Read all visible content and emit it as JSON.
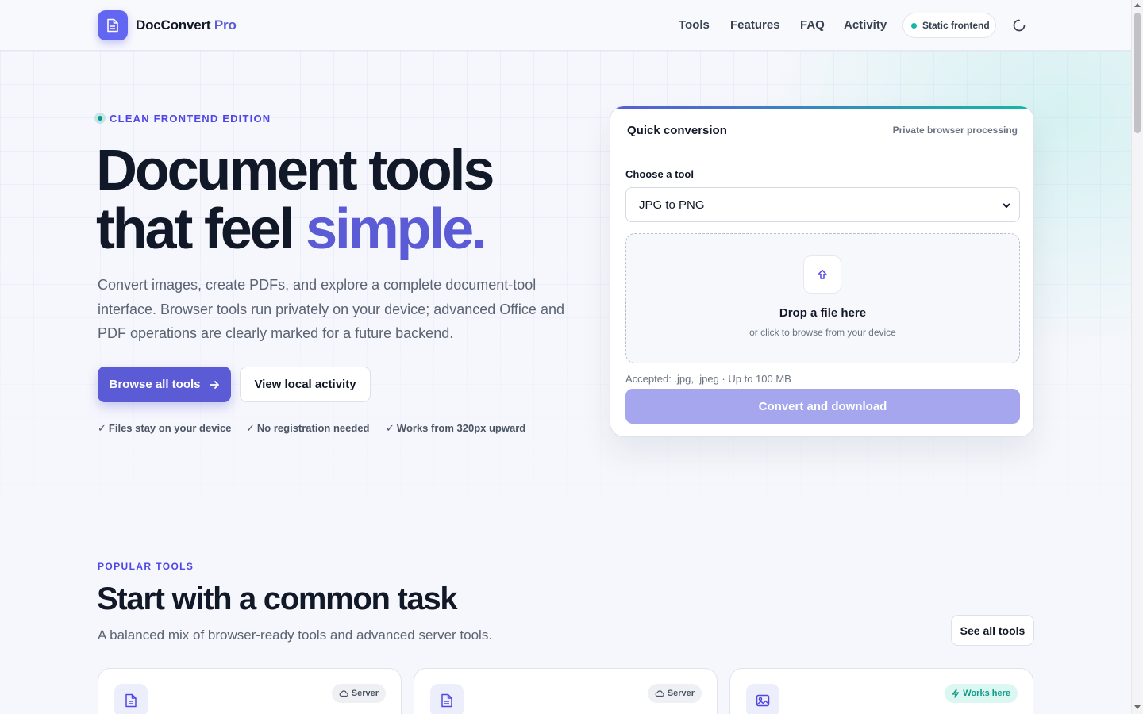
{
  "header": {
    "brand_name": "DocConvert",
    "brand_suffix": "Pro",
    "nav": [
      {
        "label": "Tools"
      },
      {
        "label": "Features"
      },
      {
        "label": "FAQ"
      },
      {
        "label": "Activity"
      }
    ],
    "status_label": "Static frontend",
    "icons": {
      "logo": "document-icon",
      "theme": "moon-icon"
    }
  },
  "hero": {
    "eyebrow": "CLEAN FRONTEND EDITION",
    "title_line1": "Document tools",
    "title_line2_prefix": "that feel ",
    "title_accent": "simple.",
    "description": "Convert images, create PDFs, and explore a complete document-tool interface. Browser tools run privately on your device; advanced Office and PDF operations are clearly marked for a future backend.",
    "primary_button": "Browse all tools",
    "secondary_button": "View local activity",
    "checks": [
      "Files stay on your device",
      "No registration needed",
      "Works from 320px upward"
    ]
  },
  "quick_card": {
    "title": "Quick conversion",
    "subtitle": "Private browser processing",
    "field_label": "Choose a tool",
    "selected_tool": "JPG to PNG",
    "drop_title": "Drop a file here",
    "drop_subtitle": "or click to browse from your device",
    "accepted": "Accepted: .jpg, .jpeg · Up to 100 MB",
    "convert_button": "Convert and download"
  },
  "popular": {
    "eyebrow": "POPULAR TOOLS",
    "title": "Start with a common task",
    "description": "A balanced mix of browser-ready tools and advanced server tools.",
    "see_all": "See all tools",
    "cards": [
      {
        "badge": "Server",
        "icon": "document-icon"
      },
      {
        "badge": "Server",
        "icon": "document-icon"
      },
      {
        "badge": "Works here",
        "icon": "image-icon"
      }
    ]
  },
  "colors": {
    "accent": "#5b5bd6",
    "teal": "#14b8a6",
    "text": "#111827",
    "muted": "#5b6473"
  }
}
